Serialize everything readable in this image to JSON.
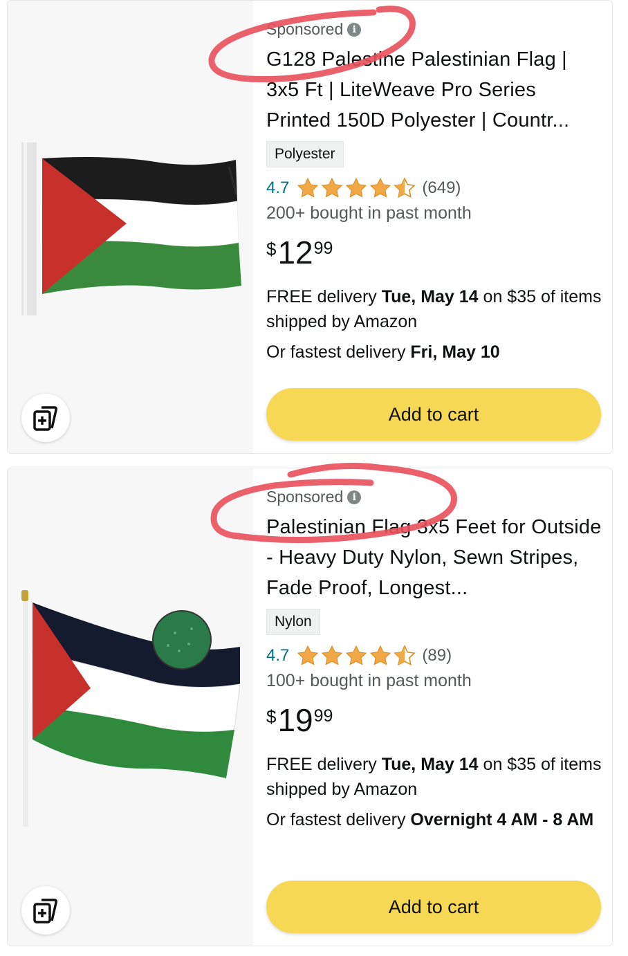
{
  "products": [
    {
      "sponsored_label": "Sponsored",
      "title": "G128 Palestine Palestinian Flag | 3x5 Ft | LiteWeave Pro Series Printed 150D Polyester | Countr...",
      "material_badge": "Polyester",
      "rating": "4.7",
      "rating_count": "(649)",
      "bought": "200+ bought in past month",
      "price_symbol": "$",
      "price_whole": "12",
      "price_fraction": "99",
      "delivery_prefix": "FREE delivery ",
      "delivery_date": "Tue, May 14",
      "delivery_suffix": " on $35 of items shipped by Amazon",
      "fastest_prefix": "Or fastest delivery ",
      "fastest_date": "Fri, May 10",
      "add_to_cart": "Add to cart",
      "compare_icon": "compare-add-icon"
    },
    {
      "sponsored_label": "Sponsored",
      "title": "Palestinian Flag 3x5 Feet for Outside - Heavy Duty Nylon, Sewn Stripes, Fade Proof, Longest...",
      "material_badge": "Nylon",
      "rating": "4.7",
      "rating_count": "(89)",
      "bought": "100+ bought in past month",
      "price_symbol": "$",
      "price_whole": "19",
      "price_fraction": "99",
      "delivery_prefix": "FREE delivery ",
      "delivery_date": "Tue, May 14",
      "delivery_suffix": " on $35 of items shipped by Amazon",
      "fastest_prefix": "Or fastest delivery ",
      "fastest_date": "Overnight 4 AM - 8 AM",
      "add_to_cart": "Add to cart",
      "compare_icon": "compare-add-icon"
    }
  ],
  "colors": {
    "star": "#f3a847",
    "cart_button": "#f7d854",
    "rating_link": "#007185",
    "annotation": "#e8505b",
    "flag_black": "#1c1c1c",
    "flag_white": "#ffffff",
    "flag_green": "#3a8a3e",
    "flag_red": "#c8302c"
  }
}
